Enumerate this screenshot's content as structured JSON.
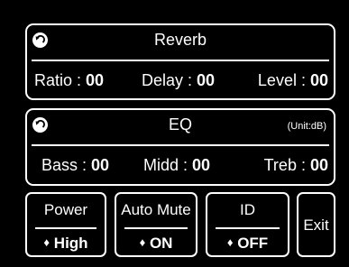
{
  "reverb": {
    "title": "Reverb",
    "back_icon": "back-arrow-icon",
    "params": [
      {
        "label": "Ratio",
        "value": "00"
      },
      {
        "label": "Delay",
        "value": "00"
      },
      {
        "label": "Level",
        "value": "00"
      }
    ]
  },
  "eq": {
    "title": "EQ",
    "unit": "(Unit:dB)",
    "back_icon": "back-arrow-icon",
    "params": [
      {
        "label": "Bass",
        "value": "00"
      },
      {
        "label": "Midd",
        "value": "00"
      },
      {
        "label": "Treb",
        "value": "00"
      }
    ]
  },
  "buttons": {
    "power": {
      "label": "Power",
      "marker": "♦",
      "value": "High"
    },
    "auto_mute": {
      "label": "Auto Mute",
      "marker": "♦",
      "value": "ON"
    },
    "id": {
      "label": "ID",
      "marker": "♦",
      "value": "OFF"
    },
    "exit": {
      "label": "Exit"
    }
  },
  "colors": {
    "background": "#000000",
    "foreground": "#ffffff"
  }
}
